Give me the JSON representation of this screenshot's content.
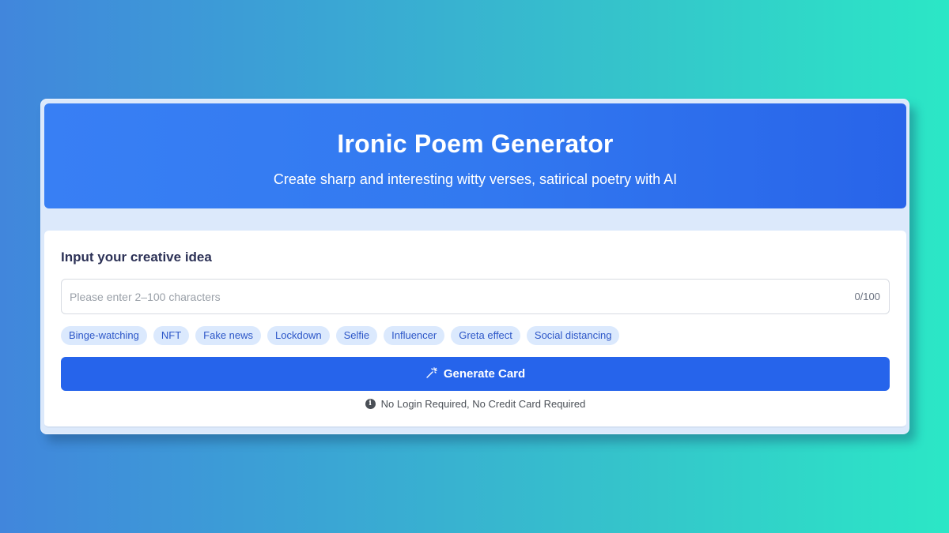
{
  "header": {
    "title": "Ironic Poem Generator",
    "subtitle": "Create sharp and interesting witty verses, satirical poetry with AI"
  },
  "form": {
    "section_title": "Input your creative idea",
    "input": {
      "value": "",
      "placeholder": "Please enter 2–100 characters",
      "counter": "0/100"
    },
    "tags": [
      "Binge-watching",
      "NFT",
      "Fake news",
      "Lockdown",
      "Selfie",
      "Influencer",
      "Greta effect",
      "Social distancing"
    ],
    "generate_button": {
      "icon": "magic-wand-icon",
      "icon_glyph": "⚚",
      "label": "Generate Card"
    },
    "note": {
      "icon": "info-icon",
      "icon_glyph": "i",
      "text": "No Login Required, No Credit Card Required"
    }
  },
  "colors": {
    "primary": "#2664eb",
    "header_gradient_start": "#387ff4",
    "header_gradient_end": "#2864e9",
    "tag_bg": "#dbe9fd",
    "tag_text": "#2d57c8",
    "title_text": "#2c3156",
    "background_gradient_start": "#4186dc",
    "background_gradient_end": "#2be7c6"
  }
}
